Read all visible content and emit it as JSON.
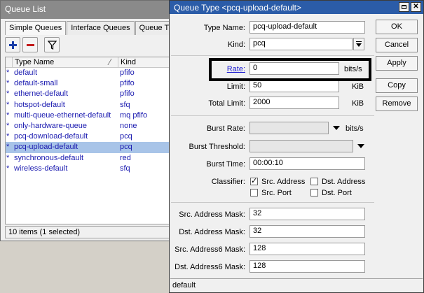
{
  "queue_list": {
    "title": "Queue List",
    "tabs": [
      "Simple Queues",
      "Interface Queues",
      "Queue Tre"
    ],
    "columns": {
      "name": "Type Name",
      "kind": "Kind"
    },
    "rows": [
      {
        "mark": "*",
        "name": "default",
        "kind": "pfifo"
      },
      {
        "mark": "*",
        "name": "default-small",
        "kind": "pfifo"
      },
      {
        "mark": "*",
        "name": "ethernet-default",
        "kind": "pfifo"
      },
      {
        "mark": "*",
        "name": "hotspot-default",
        "kind": "sfq"
      },
      {
        "mark": "*",
        "name": "multi-queue-ethernet-default",
        "kind": "mq pfifo"
      },
      {
        "mark": "*",
        "name": "only-hardware-queue",
        "kind": "none"
      },
      {
        "mark": "*",
        "name": "pcq-download-default",
        "kind": "pcq"
      },
      {
        "mark": "*",
        "name": "pcq-upload-default",
        "kind": "pcq"
      },
      {
        "mark": "*",
        "name": "synchronous-default",
        "kind": "red"
      },
      {
        "mark": "*",
        "name": "wireless-default",
        "kind": "sfq"
      }
    ],
    "selected_row": 7,
    "status": "10 items (1 selected)"
  },
  "dialog": {
    "title": "Queue Type <pcq-upload-default>",
    "fields": {
      "type_name": {
        "label": "Type Name:",
        "value": "pcq-upload-default"
      },
      "kind": {
        "label": "Kind:",
        "value": "pcq"
      },
      "rate": {
        "label": "Rate:",
        "value": "0",
        "unit": "bits/s"
      },
      "limit": {
        "label": "Limit:",
        "value": "50",
        "unit": "KiB"
      },
      "total_limit": {
        "label": "Total Limit:",
        "value": "2000",
        "unit": "KiB"
      },
      "burst_rate": {
        "label": "Burst Rate:",
        "value": "",
        "unit": "bits/s"
      },
      "burst_threshold": {
        "label": "Burst Threshold:",
        "value": ""
      },
      "burst_time": {
        "label": "Burst Time:",
        "value": "00:00:10"
      },
      "classifier": {
        "label": "Classifier:",
        "options": [
          {
            "label": "Src. Address",
            "checked": true
          },
          {
            "label": "Dst. Address",
            "checked": false
          },
          {
            "label": "Src. Port",
            "checked": false
          },
          {
            "label": "Dst. Port",
            "checked": false
          }
        ]
      },
      "src_mask": {
        "label": "Src. Address Mask:",
        "value": "32"
      },
      "dst_mask": {
        "label": "Dst. Address Mask:",
        "value": "32"
      },
      "src_mask6": {
        "label": "Src. Address6 Mask:",
        "value": "128"
      },
      "dst_mask6": {
        "label": "Dst. Address6 Mask:",
        "value": "128"
      }
    },
    "buttons": {
      "ok": "OK",
      "cancel": "Cancel",
      "apply": "Apply",
      "copy": "Copy",
      "remove": "Remove"
    },
    "status": "default"
  }
}
